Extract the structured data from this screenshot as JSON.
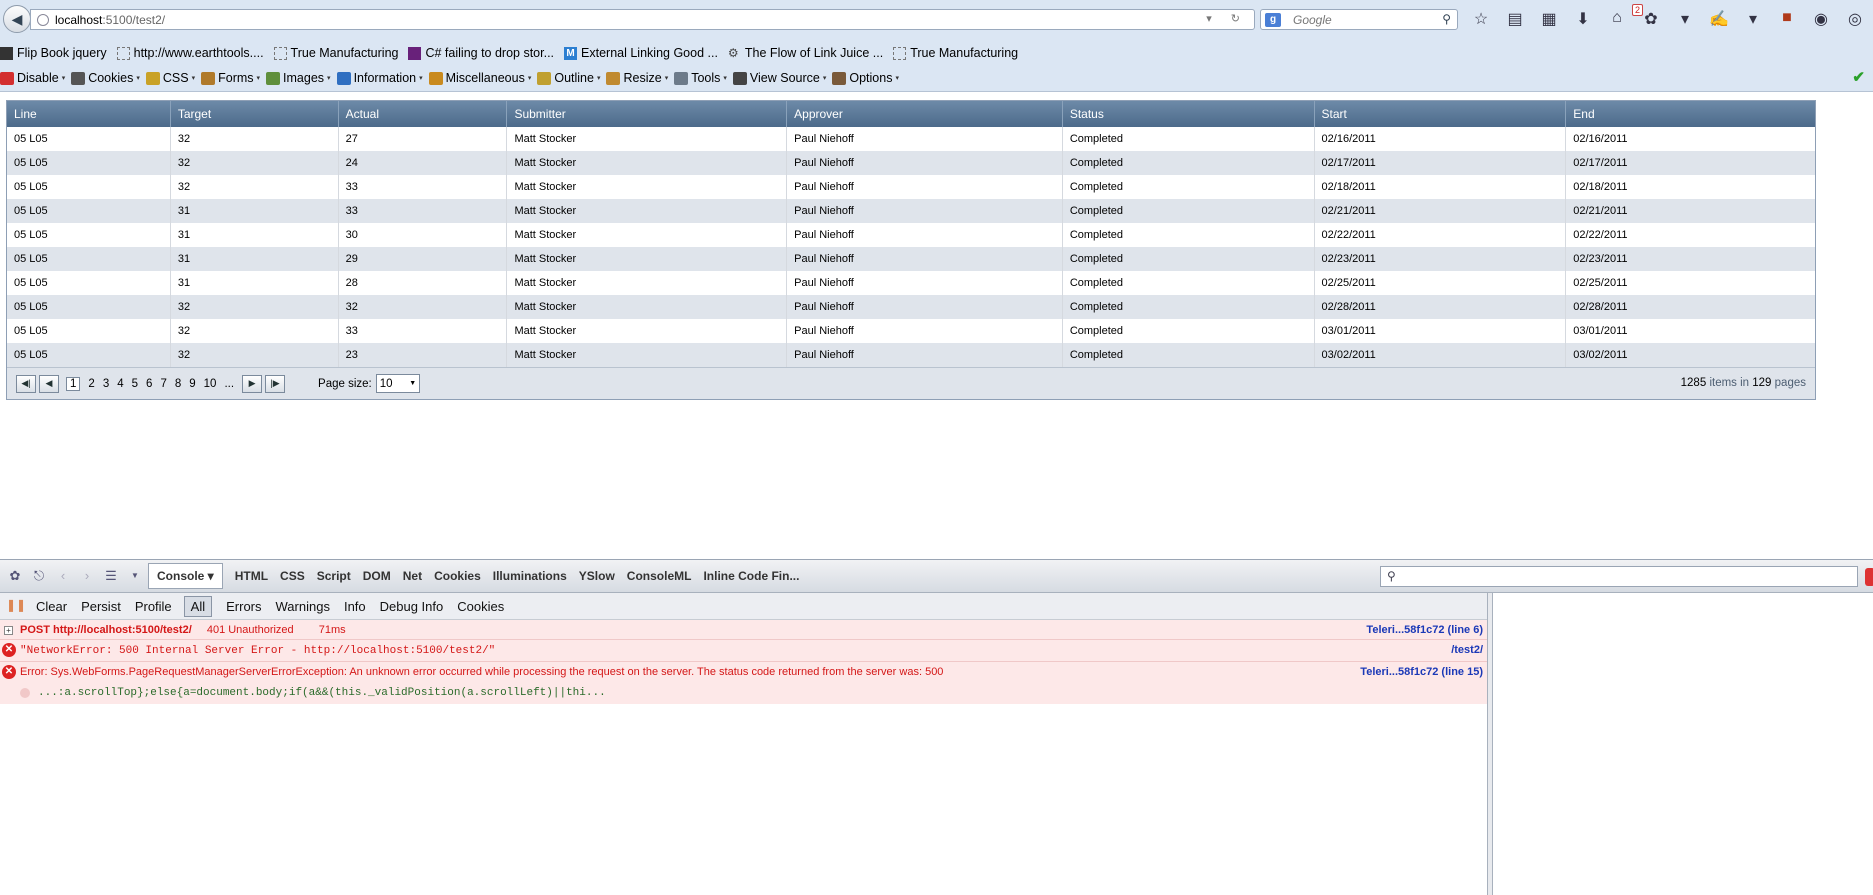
{
  "browser": {
    "url_host": "localhost",
    "url_rest": ":5100/test2/",
    "search_placeholder": "Google",
    "downloads_badge": "2"
  },
  "bookmarks": [
    {
      "label": "Flip Book jquery",
      "icon": "book-icon"
    },
    {
      "label": "http://www.earthtools....",
      "icon": "page-icon"
    },
    {
      "label": "True Manufacturing",
      "icon": "page-icon"
    },
    {
      "label": "C# failing to drop stor...",
      "icon": "visual-studio-icon"
    },
    {
      "label": "External Linking Good ...",
      "icon": "m-icon"
    },
    {
      "label": "The Flow of Link Juice ...",
      "icon": "gear-icon"
    },
    {
      "label": "True Manufacturing",
      "icon": "page-icon"
    }
  ],
  "webdev_toolbar": [
    {
      "label": "Disable",
      "icon": "disable-icon",
      "color": "#d32f2f"
    },
    {
      "label": "Cookies",
      "icon": "cookies-icon",
      "color": "#555555"
    },
    {
      "label": "CSS",
      "icon": "css-icon",
      "color": "#c9a227"
    },
    {
      "label": "Forms",
      "icon": "forms-icon",
      "color": "#b07a2a"
    },
    {
      "label": "Images",
      "icon": "images-icon",
      "color": "#5f8f3c"
    },
    {
      "label": "Information",
      "icon": "information-icon",
      "color": "#2f6fc1"
    },
    {
      "label": "Miscellaneous",
      "icon": "miscellaneous-icon",
      "color": "#c98a1e"
    },
    {
      "label": "Outline",
      "icon": "outline-icon",
      "color": "#c0a030"
    },
    {
      "label": "Resize",
      "icon": "resize-icon",
      "color": "#c08a30"
    },
    {
      "label": "Tools",
      "icon": "tools-icon",
      "color": "#6d7b8a"
    },
    {
      "label": "View Source",
      "icon": "view-source-icon",
      "color": "#444444"
    },
    {
      "label": "Options",
      "icon": "options-icon",
      "color": "#7a5a3a"
    }
  ],
  "grid": {
    "columns": [
      "Line",
      "Target",
      "Actual",
      "Submitter",
      "Approver",
      "Status",
      "Start",
      "End"
    ],
    "rows": [
      [
        "05 L05",
        "32",
        "27",
        "Matt Stocker",
        "Paul Niehoff",
        "Completed",
        "02/16/2011",
        "02/16/2011"
      ],
      [
        "05 L05",
        "32",
        "24",
        "Matt Stocker",
        "Paul Niehoff",
        "Completed",
        "02/17/2011",
        "02/17/2011"
      ],
      [
        "05 L05",
        "32",
        "33",
        "Matt Stocker",
        "Paul Niehoff",
        "Completed",
        "02/18/2011",
        "02/18/2011"
      ],
      [
        "05 L05",
        "31",
        "33",
        "Matt Stocker",
        "Paul Niehoff",
        "Completed",
        "02/21/2011",
        "02/21/2011"
      ],
      [
        "05 L05",
        "31",
        "30",
        "Matt Stocker",
        "Paul Niehoff",
        "Completed",
        "02/22/2011",
        "02/22/2011"
      ],
      [
        "05 L05",
        "31",
        "29",
        "Matt Stocker",
        "Paul Niehoff",
        "Completed",
        "02/23/2011",
        "02/23/2011"
      ],
      [
        "05 L05",
        "31",
        "28",
        "Matt Stocker",
        "Paul Niehoff",
        "Completed",
        "02/25/2011",
        "02/25/2011"
      ],
      [
        "05 L05",
        "32",
        "32",
        "Matt Stocker",
        "Paul Niehoff",
        "Completed",
        "02/28/2011",
        "02/28/2011"
      ],
      [
        "05 L05",
        "32",
        "33",
        "Matt Stocker",
        "Paul Niehoff",
        "Completed",
        "03/01/2011",
        "03/01/2011"
      ],
      [
        "05 L05",
        "32",
        "23",
        "Matt Stocker",
        "Paul Niehoff",
        "Completed",
        "03/02/2011",
        "03/02/2011"
      ]
    ],
    "pager": {
      "pages": [
        "1",
        "2",
        "3",
        "4",
        "5",
        "6",
        "7",
        "8",
        "9",
        "10",
        "..."
      ],
      "current_page": "1",
      "page_size_label": "Page size:",
      "page_size": "10",
      "total_items": "1285",
      "items_in": "items in",
      "total_pages": "129",
      "pages_word": "pages"
    }
  },
  "firebug": {
    "tabs": [
      "Console",
      "HTML",
      "CSS",
      "Script",
      "DOM",
      "Net",
      "Cookies",
      "Illuminations",
      "YSlow",
      "ConsoleML",
      "Inline Code Fin..."
    ],
    "active_tab": "Console",
    "console_buttons": [
      "Clear",
      "Persist",
      "Profile",
      "All",
      "Errors",
      "Warnings",
      "Info",
      "Debug Info",
      "Cookies"
    ],
    "active_filter": "All",
    "log": {
      "post_line": "POST http://localhost:5100/test2/",
      "post_status": "401 Unauthorized",
      "post_time": "71ms",
      "post_source": "Teleri...58f1c72 (line 6)",
      "network_error": "\"NetworkError: 500 Internal Server Error - http://localhost:5100/test2/\"",
      "network_error_source": "/test2/",
      "exception": "Error: Sys.WebForms.PageRequestManagerServerErrorException: An unknown error occurred while processing the request on the server. The status code returned from the server was: 500",
      "exception_source": "Teleri...58f1c72 (line 15)",
      "code_snippet": "...:a.scrollTop};else{a=document.body;if(a&&(this._validPosition(a.scrollLeft)||thi..."
    }
  }
}
